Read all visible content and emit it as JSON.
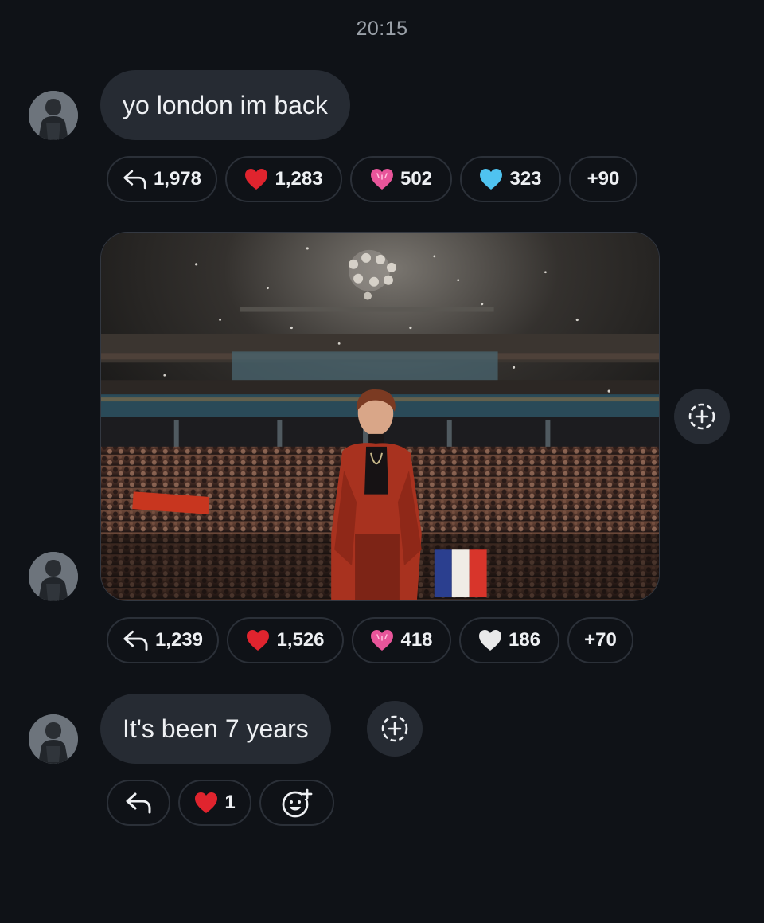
{
  "header": {
    "timestamp": "20:15"
  },
  "messages": [
    {
      "text": "yo london im back",
      "reactions": [
        {
          "icon": "reply-icon",
          "count": "1,978"
        },
        {
          "icon": "red-heart-icon",
          "count": "1,283"
        },
        {
          "icon": "pink-heart-icon",
          "count": "502"
        },
        {
          "icon": "blue-heart-icon",
          "count": "323"
        },
        {
          "label": "+90"
        }
      ]
    },
    {
      "image": "concert-stage-photo",
      "reactions": [
        {
          "icon": "reply-icon",
          "count": "1,239"
        },
        {
          "icon": "red-heart-icon",
          "count": "1,526"
        },
        {
          "icon": "pink-heart-icon",
          "count": "418"
        },
        {
          "icon": "white-heart-icon",
          "count": "186"
        },
        {
          "label": "+70"
        }
      ]
    },
    {
      "text": "It's been 7 years",
      "reactions": [
        {
          "icon": "reply-icon"
        },
        {
          "icon": "red-heart-icon",
          "count": "1"
        },
        {
          "icon": "add-emoji-icon"
        }
      ]
    }
  ],
  "colors": {
    "background": "#0f1217",
    "bubble": "#262b33",
    "red_heart": "#e0242e",
    "pink_heart": "#e8559a",
    "blue_heart": "#4fc3f0",
    "white_heart": "#e9e9e9"
  }
}
